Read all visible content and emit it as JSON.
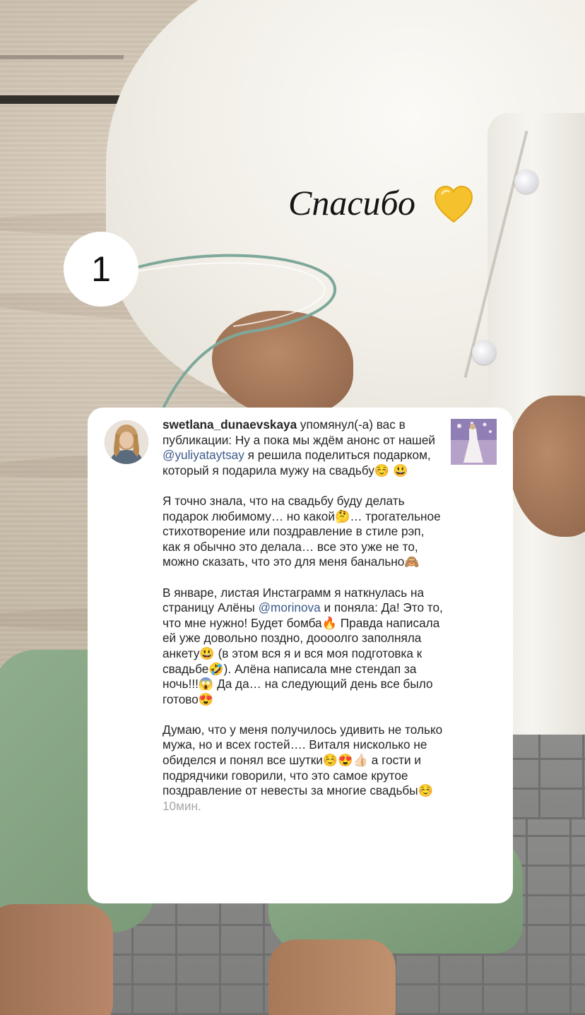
{
  "story": {
    "number_sticker": "1",
    "thanks_text": "Спасибо"
  },
  "notification": {
    "username": "swetlana_dunaevskaya",
    "action": " упомянул(-а) вас в публикации: ",
    "p1_a": "Ну а пока мы ждём анонс от нашей ",
    "mention1": "@yuliyataytsay",
    "p1_b": " я решила поделиться подарком, который я подарила мужу на свадьбу☺️ 😃",
    "p2": "Я точно знала, что на свадьбу буду делать подарок любимому… но какой🤔… трогательное стихотворение или поздравление в стиле рэп, как я обычно это делала… все это уже не то, можно сказать, что это для меня банально🙈",
    "p3_a": "В январе, листая Инстаграмм я наткнулась  на страницу Алёны ",
    "mention2": "@morinova",
    "p3_b": " и поняла: Да! Это то, что мне нужно! Будет бомба🔥 Правда написала ей уже довольно поздно, доооолго заполняла анкету😃 (в этом вся я и вся моя подготовка к свадьбе🤣). Алёна написала мне стендап за ночь!!!😱 Да да… на следующий день все было готово😍",
    "p4": "Думаю, что у меня получилось удивить не только мужа, но и всех гостей…. Виталя нисколько не обиделся и понял все шутки☺️😍👍🏻 а гости и подрядчики говорили, что это самое крутое поздравление от невесты за многие свадьбы☺️ ",
    "time": "10мин."
  },
  "colors": {
    "card_bg": "#ffffff",
    "mention": "#3d5a8a",
    "timestamp": "#a8a8a8",
    "heart": "#f5c22e"
  },
  "icons": [
    "yellow-heart-icon"
  ]
}
